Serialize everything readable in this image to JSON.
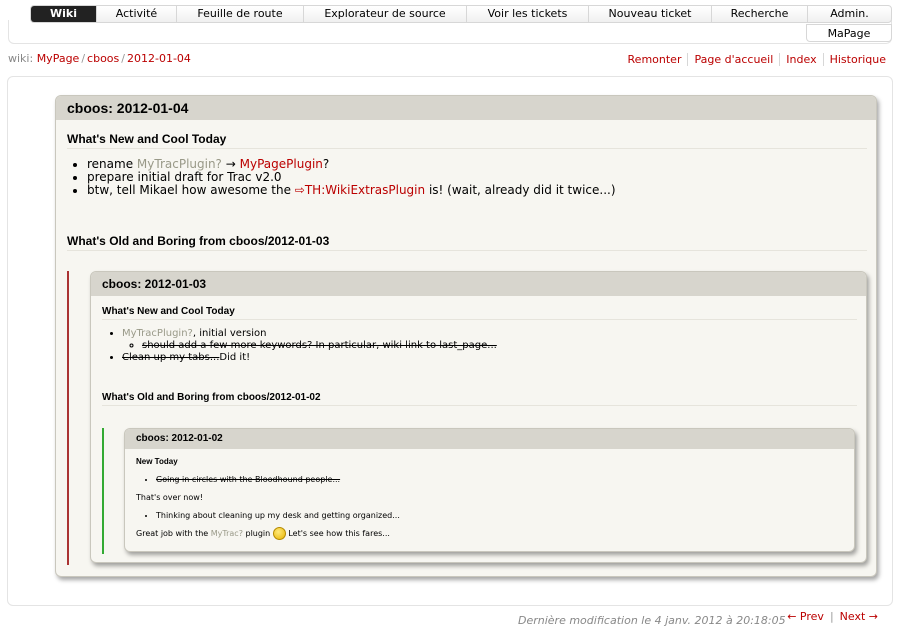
{
  "mainnav": {
    "items": [
      "Wiki",
      "Activité",
      "Feuille de route",
      "Explorateur de source",
      "Voir les tickets",
      "Nouveau ticket",
      "Recherche",
      "Admin."
    ],
    "submenu": "MaPage"
  },
  "breadcrumb": {
    "prefix": "wiki:",
    "parts": [
      "MyPage",
      "cboos",
      "2012-01-04"
    ]
  },
  "ctxtnav": [
    "Remonter",
    "Page d'accueil",
    "Index",
    "Historique"
  ],
  "page": {
    "title": "cboos: 2012-01-04",
    "new_heading": "What's New and Cool Today",
    "items": {
      "rename_prefix": "rename",
      "rename_from": "MyTracPlugin?",
      "arrow": "→",
      "rename_to": "MyPagePlugin",
      "rename_q": "?",
      "draft": "prepare initial draft for Trac v2.0",
      "btw_prefix": "btw, tell Mikael how awesome the",
      "btw_link": "⇨TH:WikiExtrasPlugin",
      "btw_suffix": "is! (wait, already did it twice...)"
    },
    "old_heading": "What's Old and Boring from cboos/2012-01-03",
    "embed1": {
      "title": "cboos: 2012-01-03",
      "new_heading": "What's New and Cool Today",
      "item1_link": "MyTracPlugin?",
      "item1_text": ", initial version",
      "subitem": "should add a few more keywords? In particular, wiki link to last_page...",
      "item2_strike": "Clean up my tabs...",
      "item2_text": "Did it!",
      "old_heading": "What's Old and Boring from cboos/2012-01-02",
      "embed2": {
        "title": "cboos: 2012-01-02",
        "new_heading": "New Today",
        "item1_strike": "Going in circles with the Bloodhound people...",
        "over": "That's over now!",
        "item2": "Thinking about cleaning up my desk and getting organized...",
        "great_prefix": "Great job with the",
        "great_link": "MyTrac?",
        "great_mid": "plugin",
        "great_suffix": "Let's see how this fares..."
      }
    }
  },
  "footer": {
    "modified": "Dernière modification le 4 janv. 2012 à 20:18:05",
    "prev": "← Prev",
    "next": "Next →"
  }
}
